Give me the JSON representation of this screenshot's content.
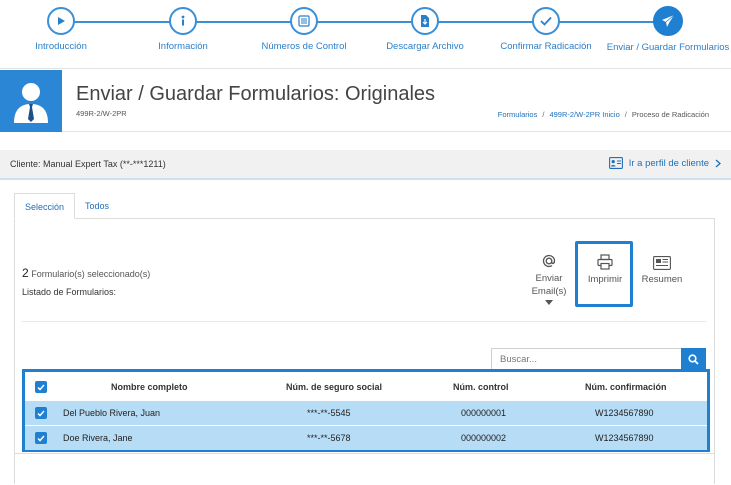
{
  "stepper": {
    "steps": [
      {
        "label": "Introducción",
        "icon": "play-icon"
      },
      {
        "label": "Información",
        "icon": "info-icon"
      },
      {
        "label": "Números de Control",
        "icon": "list-icon"
      },
      {
        "label": "Descargar Archivo",
        "icon": "download-file-icon"
      },
      {
        "label": "Confirmar Radicación",
        "icon": "check-icon"
      },
      {
        "label": "Enviar / Guardar Formularios",
        "icon": "paper-plane-icon"
      }
    ],
    "active_index": 5
  },
  "header": {
    "title": "Enviar / Guardar Formularios: Originales",
    "subtitle": "499R-2/W-2PR",
    "breadcrumb": {
      "item1": "Formularios",
      "item2": "499R-2/W-2PR Inicio",
      "item3": "Proceso de Radicación"
    }
  },
  "client": {
    "label": "Cliente: Manual Expert Tax (**-***1211)",
    "profile_link": "Ir a perfil de cliente"
  },
  "tabs": {
    "selection": "Selección",
    "all": "Todos"
  },
  "selection": {
    "count": "2",
    "count_suffix": "Formulario(s) seleccionado(s)",
    "list_label": "Listado de Formularios:"
  },
  "actions": {
    "email_line1": "Enviar",
    "email_line2": "Email(s)",
    "print": "Imprimir",
    "summary": "Resumen"
  },
  "search": {
    "placeholder": "Buscar..."
  },
  "table": {
    "headers": {
      "name": "Nombre completo",
      "ssn": "Núm. de seguro social",
      "control": "Núm. control",
      "confirmation": "Núm. confirmación"
    },
    "rows": [
      {
        "name": "Del Pueblo Rivera, Juan",
        "ssn": "***-**-5545",
        "control": "000000001",
        "confirmation": "W1234567890",
        "checked": true
      },
      {
        "name": "Doe Rivera, Jane",
        "ssn": "***-**-5678",
        "control": "000000002",
        "confirmation": "W1234567890",
        "checked": true
      }
    ]
  },
  "colors": {
    "accent": "#1f7fd0",
    "row_selected": "#b7dcf6"
  }
}
